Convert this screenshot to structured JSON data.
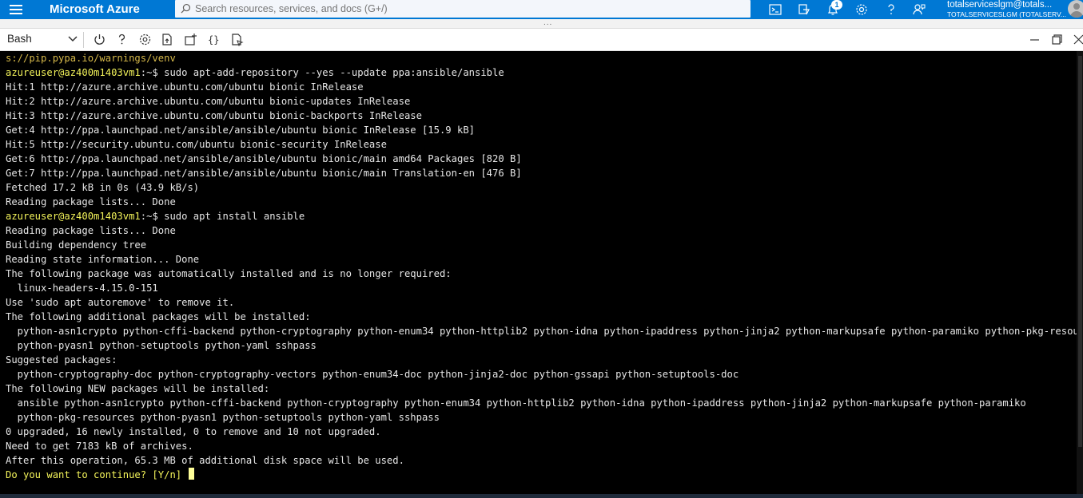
{
  "topbar": {
    "brand": "Microsoft Azure",
    "search_placeholder": "Search resources, services, and docs (G+/)",
    "notification_count": "1",
    "account_email": "totalserviceslgm@totals...",
    "account_tenant": "TOTALSERVICESLGM (TOTALSERV..."
  },
  "shell": {
    "type_label": "Bash"
  },
  "terminal": {
    "prompt_user": "azureuser@az400m1403vm1",
    "prompt_path": ":~$ ",
    "lines": [
      {
        "kind": "warn",
        "text": "s://pip.pypa.io/warnings/venv"
      },
      {
        "kind": "prompt",
        "text": "sudo apt-add-repository --yes --update ppa:ansible/ansible"
      },
      {
        "kind": "out",
        "text": "Hit:1 http://azure.archive.ubuntu.com/ubuntu bionic InRelease"
      },
      {
        "kind": "out",
        "text": "Hit:2 http://azure.archive.ubuntu.com/ubuntu bionic-updates InRelease"
      },
      {
        "kind": "out",
        "text": "Hit:3 http://azure.archive.ubuntu.com/ubuntu bionic-backports InRelease"
      },
      {
        "kind": "out",
        "text": "Get:4 http://ppa.launchpad.net/ansible/ansible/ubuntu bionic InRelease [15.9 kB]"
      },
      {
        "kind": "out",
        "text": "Hit:5 http://security.ubuntu.com/ubuntu bionic-security InRelease"
      },
      {
        "kind": "out",
        "text": "Get:6 http://ppa.launchpad.net/ansible/ansible/ubuntu bionic/main amd64 Packages [820 B]"
      },
      {
        "kind": "out",
        "text": "Get:7 http://ppa.launchpad.net/ansible/ansible/ubuntu bionic/main Translation-en [476 B]"
      },
      {
        "kind": "out",
        "text": "Fetched 17.2 kB in 0s (43.9 kB/s)"
      },
      {
        "kind": "out",
        "text": "Reading package lists... Done"
      },
      {
        "kind": "prompt",
        "text": "sudo apt install ansible"
      },
      {
        "kind": "out",
        "text": "Reading package lists... Done"
      },
      {
        "kind": "out",
        "text": "Building dependency tree"
      },
      {
        "kind": "out",
        "text": "Reading state information... Done"
      },
      {
        "kind": "out",
        "text": "The following package was automatically installed and is no longer required:"
      },
      {
        "kind": "out",
        "text": "  linux-headers-4.15.0-151"
      },
      {
        "kind": "out",
        "text": "Use 'sudo apt autoremove' to remove it."
      },
      {
        "kind": "out",
        "text": "The following additional packages will be installed:"
      },
      {
        "kind": "out",
        "text": "  python-asn1crypto python-cffi-backend python-cryptography python-enum34 python-httplib2 python-idna python-ipaddress python-jinja2 python-markupsafe python-paramiko python-pkg-resources"
      },
      {
        "kind": "out",
        "text": "  python-pyasn1 python-setuptools python-yaml sshpass"
      },
      {
        "kind": "out",
        "text": "Suggested packages:"
      },
      {
        "kind": "out",
        "text": "  python-cryptography-doc python-cryptography-vectors python-enum34-doc python-jinja2-doc python-gssapi python-setuptools-doc"
      },
      {
        "kind": "out",
        "text": "The following NEW packages will be installed:"
      },
      {
        "kind": "out",
        "text": "  ansible python-asn1crypto python-cffi-backend python-cryptography python-enum34 python-httplib2 python-idna python-ipaddress python-jinja2 python-markupsafe python-paramiko"
      },
      {
        "kind": "out",
        "text": "  python-pkg-resources python-pyasn1 python-setuptools python-yaml sshpass"
      },
      {
        "kind": "out",
        "text": "0 upgraded, 16 newly installed, 0 to remove and 10 not upgraded."
      },
      {
        "kind": "out",
        "text": "Need to get 7183 kB of archives."
      },
      {
        "kind": "out",
        "text": "After this operation, 65.3 MB of additional disk space will be used."
      },
      {
        "kind": "yellow",
        "text": "Do you want to continue? [Y/n] "
      }
    ]
  },
  "colors": {
    "azure_blue": "#0078d4",
    "prompt_yellow": "#f3f35a",
    "terminal_bg": "#000000"
  },
  "icons": [
    "hamburger-icon",
    "search-icon",
    "cloud-shell-icon",
    "directory-filter-icon",
    "notifications-icon",
    "settings-icon",
    "help-icon",
    "feedback-icon",
    "power-icon",
    "help-icon",
    "settings-icon",
    "upload-download-icon",
    "new-session-icon",
    "editor-icon",
    "web-preview-icon",
    "minimize-icon",
    "restore-icon",
    "close-icon"
  ]
}
